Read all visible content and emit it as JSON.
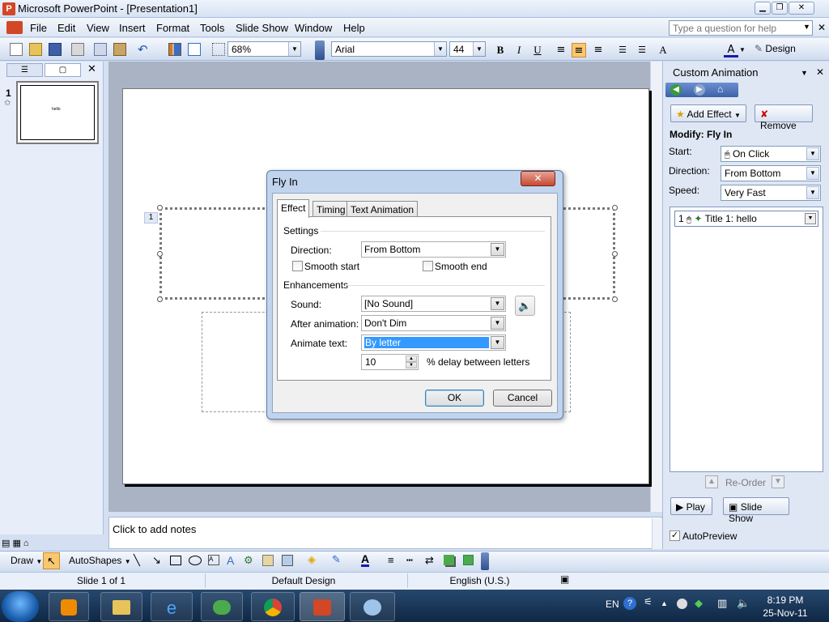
{
  "window": {
    "title": "Microsoft PowerPoint - [Presentation1]"
  },
  "menu": {
    "file": "File",
    "edit": "Edit",
    "view": "View",
    "insert": "Insert",
    "format": "Format",
    "tools": "Tools",
    "slideshow": "Slide Show",
    "window": "Window",
    "help": "Help",
    "help_placeholder": "Type a question for help"
  },
  "toolbar": {
    "zoom": "68%",
    "font": "Arial",
    "font_size": "44",
    "design": "Design"
  },
  "slides_pane": {
    "slide_number": "1",
    "thumb_text": "hello"
  },
  "slide": {
    "anim_tag": "1"
  },
  "notes": {
    "placeholder": "Click to add notes"
  },
  "task_pane": {
    "title": "Custom Animation",
    "add_effect": "Add Effect",
    "remove": "Remove",
    "modify_heading": "Modify: Fly In",
    "start_label": "Start:",
    "start_value": "On Click",
    "direction_label": "Direction:",
    "direction_value": "From Bottom",
    "speed_label": "Speed:",
    "speed_value": "Very Fast",
    "list_item_number": "1",
    "list_item_text": "Title 1: hello",
    "reorder": "Re-Order",
    "play": "Play",
    "slideshow": "Slide Show",
    "autopreview": "AutoPreview"
  },
  "dialog": {
    "title": "Fly In",
    "tabs": {
      "effect": "Effect",
      "timing": "Timing",
      "text_animation": "Text Animation"
    },
    "settings_heading": "Settings",
    "direction_label": "Direction:",
    "direction_value": "From Bottom",
    "smooth_start": "Smooth start",
    "smooth_end": "Smooth end",
    "enhancements_heading": "Enhancements",
    "sound_label": "Sound:",
    "sound_value": "[No Sound]",
    "after_label": "After animation:",
    "after_value": "Don't Dim",
    "animate_label": "Animate text:",
    "animate_value": "By letter",
    "delay_value": "10",
    "delay_label": "% delay between letters",
    "ok": "OK",
    "cancel": "Cancel"
  },
  "drawbar": {
    "draw": "Draw",
    "autoshapes": "AutoShapes"
  },
  "status": {
    "slide": "Slide 1 of 1",
    "design": "Default Design",
    "language": "English (U.S.)"
  },
  "taskbar": {
    "lang": "EN",
    "time": "8:19 PM",
    "date": "25-Nov-11"
  },
  "colors": {
    "accent": "#3399ff",
    "office_chrome": "#d4dff2",
    "close_red": "#c44a31"
  }
}
